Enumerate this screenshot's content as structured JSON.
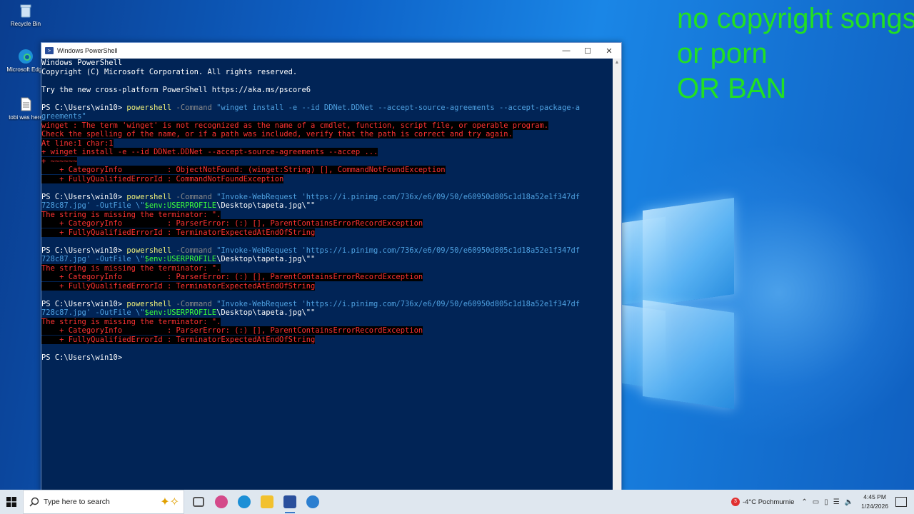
{
  "desktop": {
    "icons": [
      {
        "label": "Recycle Bin"
      },
      {
        "label": "Microsoft Edge"
      },
      {
        "label": "tobi was here"
      }
    ],
    "overlay_lines": [
      "no copyright songs",
      "or porn",
      "OR BAN"
    ]
  },
  "window": {
    "title": "Windows PowerShell",
    "minimize": "—",
    "maximize": "☐",
    "close": "✕"
  },
  "console": {
    "lines": [
      [
        {
          "t": "Windows PowerShell",
          "c": "wht"
        }
      ],
      [
        {
          "t": "Copyright (C) Microsoft Corporation. All rights reserved.",
          "c": "wht"
        }
      ],
      [
        {
          "t": "",
          "c": "wht"
        }
      ],
      [
        {
          "t": "Try the new cross-platform PowerShell https://aka.ms/pscore6",
          "c": "wht"
        }
      ],
      [
        {
          "t": "",
          "c": "wht"
        }
      ],
      [
        {
          "t": "PS C:\\Users\\win10> ",
          "c": "wht"
        },
        {
          "t": "powershell",
          "c": "yel"
        },
        {
          "t": " -Command ",
          "c": "gray"
        },
        {
          "t": "\"winget install -e --id DDNet.DDNet --accept-source-agreements --accept-package-a",
          "c": "cyan"
        }
      ],
      [
        {
          "t": "greements\"",
          "c": "cyan"
        }
      ],
      [
        {
          "t": "winget : The term 'winget' is not recognized as the name of a cmdlet, function, script file, or operable program.",
          "c": "err"
        }
      ],
      [
        {
          "t": "Check the spelling of the name, or if a path was included, verify that the path is correct and try again.",
          "c": "err"
        }
      ],
      [
        {
          "t": "At line:1 char:1",
          "c": "err"
        }
      ],
      [
        {
          "t": "+ winget install -e --id DDNet.DDNet --accept-source-agreements --accep ...",
          "c": "err"
        }
      ],
      [
        {
          "t": "+ ~~~~~~",
          "c": "err"
        }
      ],
      [
        {
          "t": "    + CategoryInfo          : ObjectNotFound: (winget:String) [], CommandNotFoundException",
          "c": "err"
        }
      ],
      [
        {
          "t": "    + FullyQualifiedErrorId : CommandNotFoundException",
          "c": "err"
        }
      ],
      [
        {
          "t": "",
          "c": "wht"
        }
      ],
      [
        {
          "t": "PS C:\\Users\\win10> ",
          "c": "wht"
        },
        {
          "t": "powershell",
          "c": "yel"
        },
        {
          "t": " -Command ",
          "c": "gray"
        },
        {
          "t": "\"Invoke-WebRequest 'https://i.pinimg.com/736x/e6/09/50/e60950d805c1d18a52e1f347df",
          "c": "cyan"
        }
      ],
      [
        {
          "t": "728c87.jpg' -OutFile \\\"",
          "c": "cyan"
        },
        {
          "t": "$env:USERPROFILE",
          "c": "grn"
        },
        {
          "t": "\\Desktop\\tapeta.jpg\\\"\"",
          "c": "wht"
        }
      ],
      [
        {
          "t": "The string is missing the terminator: \".",
          "c": "err"
        }
      ],
      [
        {
          "t": "    + CategoryInfo          : ParserError: (:) [], ParentContainsErrorRecordException",
          "c": "err"
        }
      ],
      [
        {
          "t": "    + FullyQualifiedErrorId : TerminatorExpectedAtEndOfString",
          "c": "err"
        }
      ],
      [
        {
          "t": "",
          "c": "wht"
        }
      ],
      [
        {
          "t": "PS C:\\Users\\win10> ",
          "c": "wht"
        },
        {
          "t": "powershell",
          "c": "yel"
        },
        {
          "t": " -Command ",
          "c": "gray"
        },
        {
          "t": "\"Invoke-WebRequest 'https://i.pinimg.com/736x/e6/09/50/e60950d805c1d18a52e1f347df",
          "c": "cyan"
        }
      ],
      [
        {
          "t": "728c87.jpg' -OutFile \\\"",
          "c": "cyan"
        },
        {
          "t": "$env:USERPROFILE",
          "c": "grn"
        },
        {
          "t": "\\Desktop\\tapeta.jpg\\\"\"",
          "c": "wht"
        }
      ],
      [
        {
          "t": "The string is missing the terminator: \".",
          "c": "err"
        }
      ],
      [
        {
          "t": "    + CategoryInfo          : ParserError: (:) [], ParentContainsErrorRecordException",
          "c": "err"
        }
      ],
      [
        {
          "t": "    + FullyQualifiedErrorId : TerminatorExpectedAtEndOfString",
          "c": "err"
        }
      ],
      [
        {
          "t": "",
          "c": "wht"
        }
      ],
      [
        {
          "t": "PS C:\\Users\\win10> ",
          "c": "wht"
        },
        {
          "t": "powershell",
          "c": "yel"
        },
        {
          "t": " -Command ",
          "c": "gray"
        },
        {
          "t": "\"Invoke-WebRequest 'https://i.pinimg.com/736x/e6/09/50/e60950d805c1d18a52e1f347df",
          "c": "cyan"
        }
      ],
      [
        {
          "t": "728c87.jpg' -OutFile \\\"",
          "c": "cyan"
        },
        {
          "t": "$env:USERPROFILE",
          "c": "grn"
        },
        {
          "t": "\\Desktop\\tapeta.jpg\\\"\"",
          "c": "wht"
        }
      ],
      [
        {
          "t": "The string is missing the terminator: \".",
          "c": "err"
        }
      ],
      [
        {
          "t": "    + CategoryInfo          : ParserError: (:) [], ParentContainsErrorRecordException",
          "c": "err"
        }
      ],
      [
        {
          "t": "    + FullyQualifiedErrorId : TerminatorExpectedAtEndOfString",
          "c": "err"
        }
      ],
      [
        {
          "t": "",
          "c": "wht"
        }
      ],
      [
        {
          "t": "PS C:\\Users\\win10> ",
          "c": "wht"
        }
      ]
    ]
  },
  "taskbar": {
    "search_placeholder": "Type here to search",
    "apps": [
      {
        "name": "task-view-icon",
        "color": "#555555"
      },
      {
        "name": "copilot-icon",
        "color": "#d44a8a"
      },
      {
        "name": "edge-icon",
        "color": "#1c8fd6"
      },
      {
        "name": "file-explorer-icon",
        "color": "#f2c12e"
      },
      {
        "name": "powershell-icon",
        "color": "#2a4f9c"
      },
      {
        "name": "network-globe-icon",
        "color": "#2c7fd0"
      }
    ],
    "weather": "-4°C  Pochmurnie",
    "weather_badge": "3",
    "time": "4:45 PM",
    "date": "1/24/2026"
  },
  "colors": {
    "console_bg": "#012456",
    "error_fg": "#ff3333",
    "overlay_green": "#22e022"
  }
}
